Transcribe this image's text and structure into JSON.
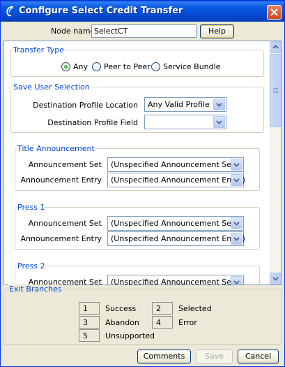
{
  "window": {
    "title": "Configure Select Credit Transfer",
    "icon": "acs-icon"
  },
  "node": {
    "label": "Node name",
    "value": "SelectCT",
    "help_label": "Help"
  },
  "transfer_type": {
    "legend": "Transfer Type",
    "options": [
      "Any",
      "Peer to Peer",
      "Service Bundle"
    ],
    "selected": "Any"
  },
  "save_user_selection": {
    "legend": "Save User Selection",
    "location_label": "Destination Profile Location",
    "location_value": "Any Valid Profile",
    "field_label": "Destination Profile Field",
    "field_value": ""
  },
  "title_announcement": {
    "legend": "Title Announcement",
    "set_label": "Announcement Set",
    "set_value": "(Unspecified Announcement Set)",
    "entry_label": "Announcement Entry",
    "entry_value": "(Unspecified Announcement Entry)"
  },
  "press1": {
    "legend": "Press 1",
    "set_label": "Announcement Set",
    "set_value": "(Unspecified Announcement Set)",
    "entry_label": "Announcement Entry",
    "entry_value": "(Unspecified Announcement Entry)"
  },
  "press2": {
    "legend": "Press 2",
    "set_label": "Announcement Set",
    "set_value": "(Unspecified Announcement Set)"
  },
  "exit_branches": {
    "legend": "Exit Branches",
    "branches": [
      {
        "num": "1",
        "name": "Success"
      },
      {
        "num": "2",
        "name": "Selected"
      },
      {
        "num": "3",
        "name": "Abandon"
      },
      {
        "num": "4",
        "name": "Error"
      },
      {
        "num": "5",
        "name": "Unsupported"
      }
    ]
  },
  "footer": {
    "comments_label": "Comments",
    "save_label": "Save",
    "cancel_label": "Cancel"
  },
  "colors": {
    "titlebar": "#0a5be0",
    "group_legend": "#0046d5",
    "dialog_bg": "#ece9d8"
  }
}
